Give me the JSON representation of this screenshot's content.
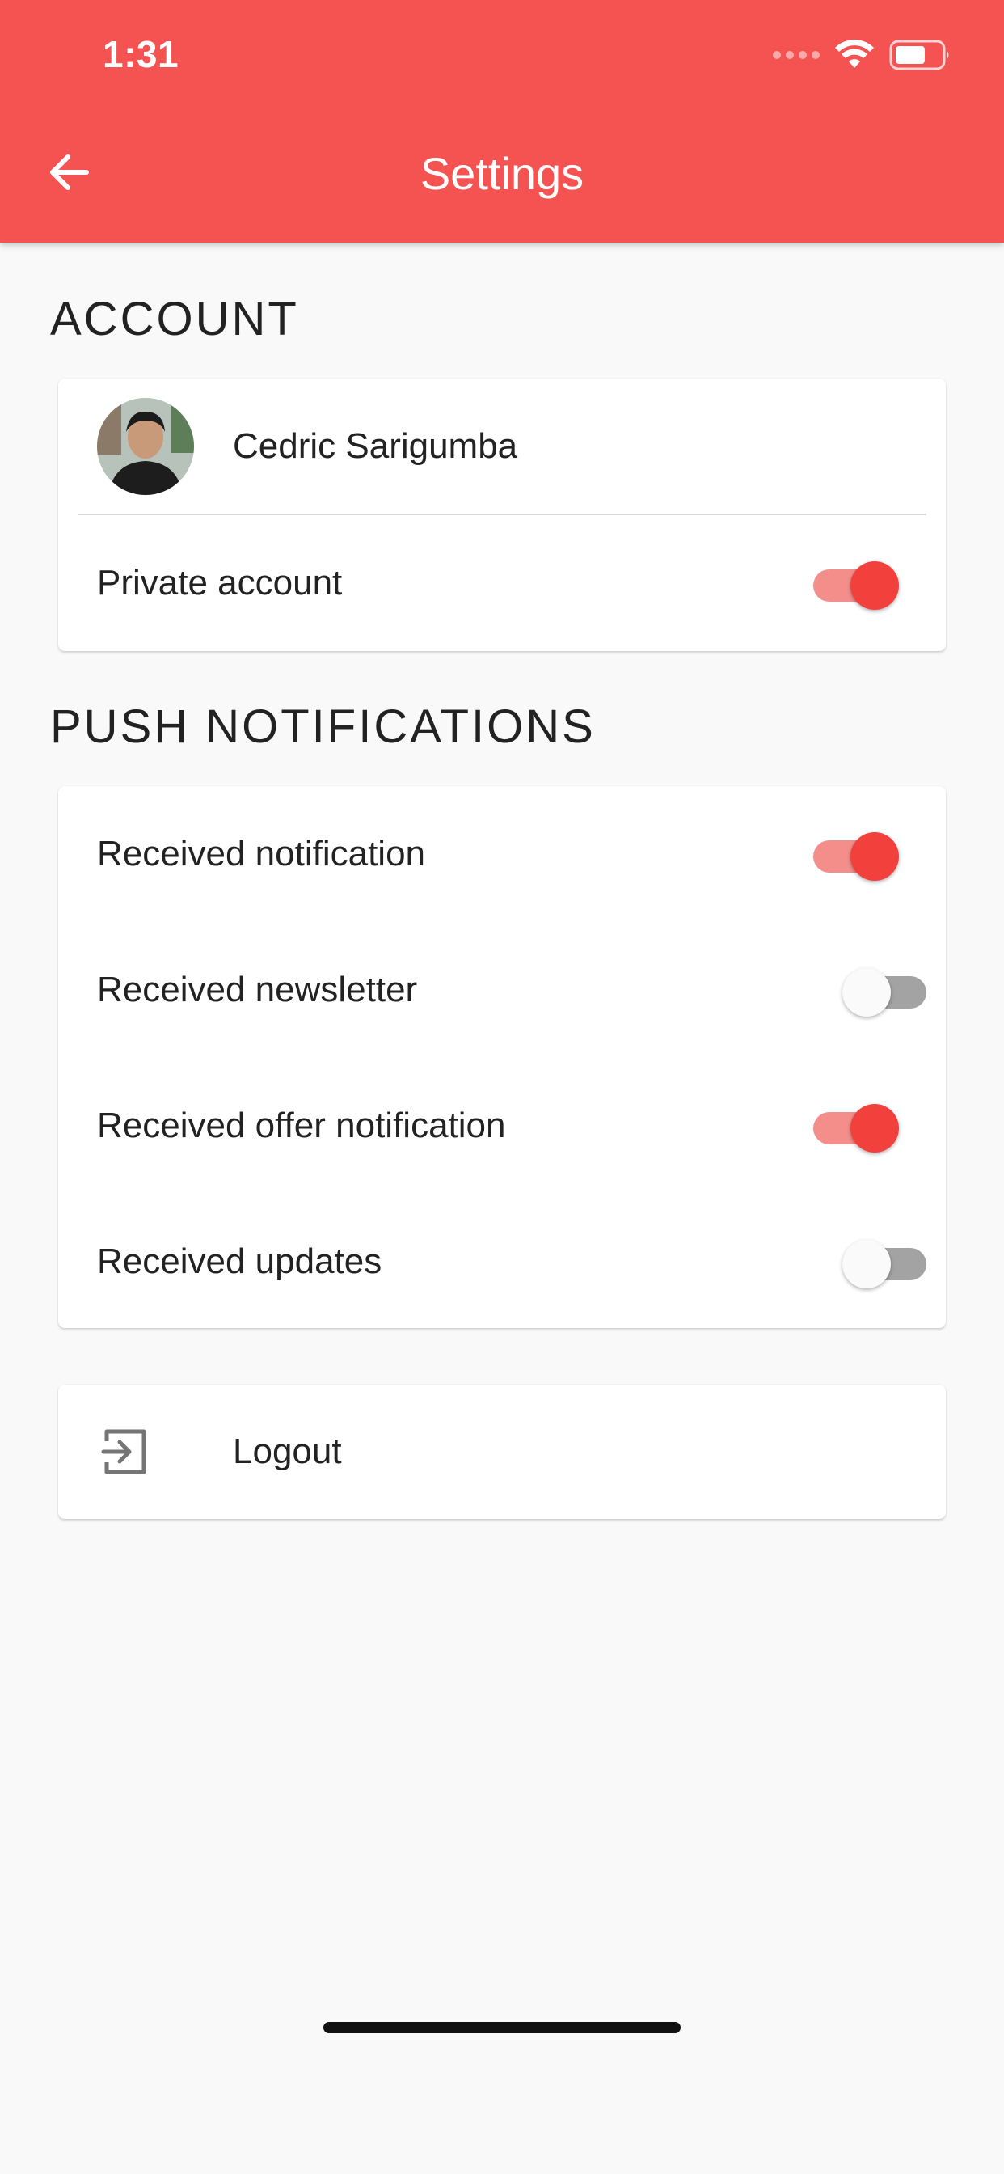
{
  "status_bar": {
    "time": "1:31",
    "icons": [
      "signal-icon",
      "wifi-icon",
      "battery-icon"
    ]
  },
  "app_bar": {
    "title": "Settings",
    "back_icon": "arrow-back-icon",
    "background_color": "#f55252"
  },
  "account": {
    "header": "ACCOUNT",
    "user_name": "Cedric Sarigumba",
    "avatar_icon": "avatar",
    "private_account_label": "Private account",
    "private_account_on": true
  },
  "push_notifications": {
    "header": "PUSH NOTIFICATIONS",
    "items": [
      {
        "label": "Received notification",
        "on": true
      },
      {
        "label": "Received newsletter",
        "on": false
      },
      {
        "label": "Received offer notification",
        "on": true
      },
      {
        "label": "Received updates",
        "on": false
      }
    ]
  },
  "logout": {
    "label": "Logout",
    "icon": "logout-icon"
  },
  "colors": {
    "accent": "#f2403c",
    "accent_track": "#f48e8b",
    "off_track": "#a3a3a3",
    "background": "#f9f9f9"
  }
}
